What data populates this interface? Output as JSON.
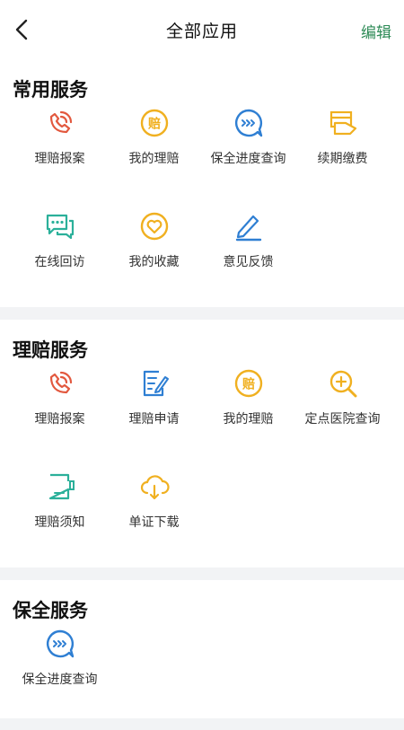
{
  "header": {
    "title": "全部应用",
    "edit_label": "编辑"
  },
  "sections": [
    {
      "title": "常用服务",
      "items": [
        {
          "label": "理赔报案",
          "icon": "phone-ring-icon"
        },
        {
          "label": "我的理赔",
          "icon": "claim-coin-icon"
        },
        {
          "label": "保全进度查询",
          "icon": "progress-bubble-icon"
        },
        {
          "label": "续期缴费",
          "icon": "payment-card-icon"
        },
        {
          "label": "在线回访",
          "icon": "chat-bubbles-icon"
        },
        {
          "label": "我的收藏",
          "icon": "heart-icon"
        },
        {
          "label": "意见反馈",
          "icon": "pencil-icon"
        }
      ]
    },
    {
      "title": "理赔服务",
      "items": [
        {
          "label": "理赔报案",
          "icon": "phone-ring-icon"
        },
        {
          "label": "理赔申请",
          "icon": "document-edit-icon"
        },
        {
          "label": "我的理赔",
          "icon": "claim-coin-icon"
        },
        {
          "label": "定点医院查询",
          "icon": "search-plus-icon"
        },
        {
          "label": "理赔须知",
          "icon": "notice-book-icon"
        },
        {
          "label": "单证下载",
          "icon": "cloud-download-icon"
        }
      ]
    },
    {
      "title": "保全服务",
      "items": [
        {
          "label": "保全进度查询",
          "icon": "progress-bubble-icon"
        }
      ]
    }
  ],
  "icon_chars": {
    "claim": "赔"
  },
  "colors": {
    "orange_red": "#e2583e",
    "yellow": "#f0b020",
    "blue": "#2f7fd3",
    "green": "#2bb09a",
    "edit_green": "#2e8b57"
  }
}
